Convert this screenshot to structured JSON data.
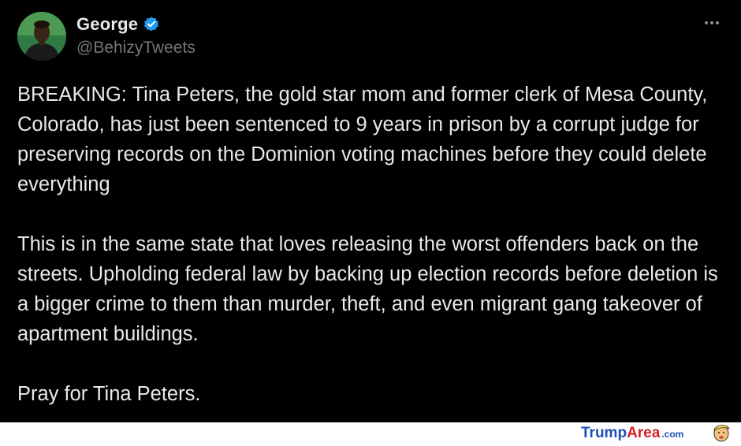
{
  "tweet": {
    "author": {
      "display_name": "George",
      "handle": "@BehizyTweets",
      "verified": true,
      "avatar_icon": "profile-photo"
    },
    "more_icon": "more-dots-icon",
    "paragraphs": [
      "BREAKING: Tina Peters, the gold star mom and former clerk of Mesa County, Colorado, has just been sentenced to 9 years in prison by a corrupt judge for preserving records on the Dominion voting machines before they could delete everything",
      "This is in the same state that loves releasing the worst offenders back on the streets. Upholding federal law by backing up election records before deletion is a bigger crime to them than murder, theft, and even migrant gang takeover of apartment buildings.",
      "Pray for Tina Peters."
    ]
  },
  "watermark": {
    "part1": "Trump",
    "part2": "Area",
    "tld": ".com"
  },
  "colors": {
    "background": "#000000",
    "text": "#e7e9ea",
    "muted": "#71767b",
    "verified_badge": "#1d9bf0",
    "brand_blue": "#1e4fb5",
    "brand_red": "#d21f26"
  }
}
